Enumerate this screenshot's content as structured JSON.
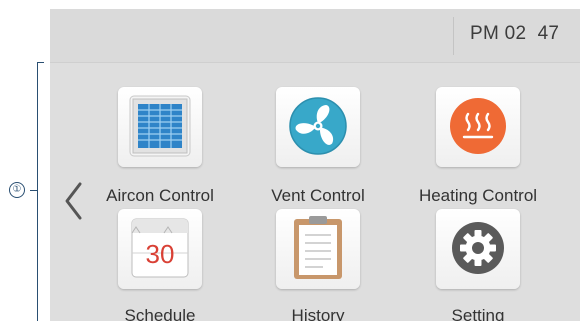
{
  "annotation": {
    "marker": "①"
  },
  "header": {
    "time": "PM 02  47"
  },
  "nav": {
    "prev_icon": "chevron-left-icon"
  },
  "menu": {
    "items": [
      {
        "label": "Aircon Control",
        "icon": "aircon-cassette-icon"
      },
      {
        "label": "Vent Control",
        "icon": "fan-icon"
      },
      {
        "label": "Heating Control",
        "icon": "heat-waves-icon"
      },
      {
        "label": "Schedule",
        "icon": "calendar-icon",
        "calendar_day": "30"
      },
      {
        "label": "History",
        "icon": "clipboard-icon"
      },
      {
        "label": "Setting",
        "icon": "gear-icon"
      }
    ]
  },
  "colors": {
    "aircon_blue": "#2f84c8",
    "vent_teal": "#38a8c9",
    "heating_orange": "#ef6a35",
    "calendar_red": "#d94035",
    "clipboard_brown": "#c8976b",
    "gear_gray": "#5a5a5a"
  }
}
